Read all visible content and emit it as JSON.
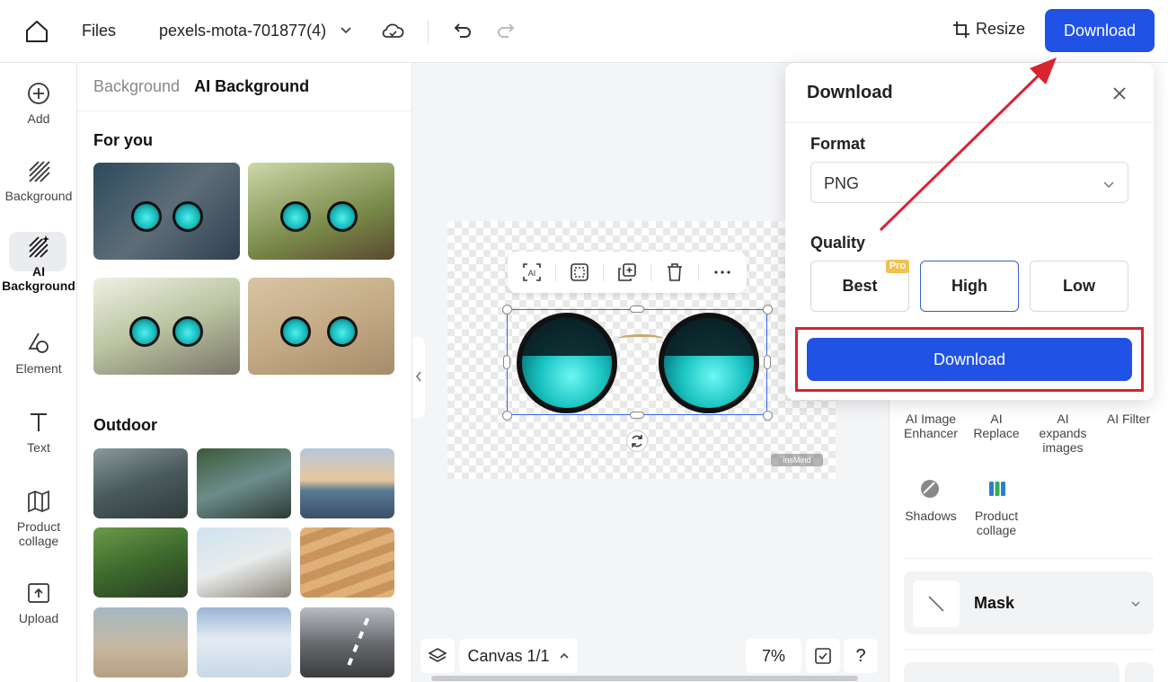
{
  "topbar": {
    "files_label": "Files",
    "file_name": "pexels-mota-701877(4)",
    "resize_label": "Resize",
    "download_label": "Download"
  },
  "rail": {
    "items": [
      {
        "label": "Add",
        "icon": "plus-circle-icon"
      },
      {
        "label": "Background",
        "icon": "hatch-icon"
      },
      {
        "label": "AI Background",
        "icon": "ai-hatch-icon"
      },
      {
        "label": "Element",
        "icon": "shapes-icon"
      },
      {
        "label": "Text",
        "icon": "text-icon"
      },
      {
        "label": "Product collage",
        "icon": "map-icon"
      },
      {
        "label": "Upload",
        "icon": "upload-icon"
      }
    ]
  },
  "panel": {
    "tabs": [
      "Background",
      "AI Background"
    ],
    "active_tab": "AI Background",
    "section_for_you": "For you",
    "section_outdoor": "Outdoor"
  },
  "canvas": {
    "label": "Canvas 1/1",
    "zoom": "7%",
    "help": "?",
    "watermark": "insMind"
  },
  "right_panel": {
    "tools": [
      "AI Image Enhancer",
      "AI Replace",
      "AI expands images",
      "AI Filter",
      "Shadows",
      "Product collage"
    ],
    "mask_label": "Mask"
  },
  "popup": {
    "title": "Download",
    "format_label": "Format",
    "format_value": "PNG",
    "quality_label": "Quality",
    "quality_options": [
      "Best",
      "High",
      "Low"
    ],
    "quality_selected": "High",
    "pro_badge": "Pro",
    "download_label": "Download"
  },
  "colors": {
    "accent": "#2152e6",
    "annotation": "#d9232e"
  }
}
